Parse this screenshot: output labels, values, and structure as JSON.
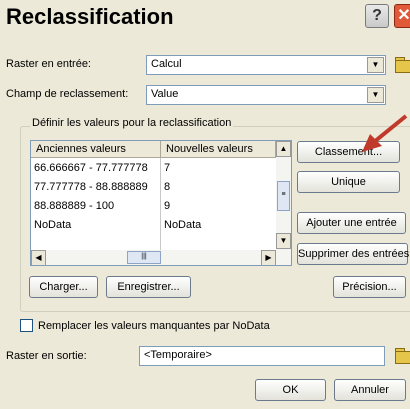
{
  "window": {
    "title": "Reclassification"
  },
  "input_raster": {
    "label": "Raster en entrée:",
    "value": "Calcul"
  },
  "reclass_field": {
    "label": "Champ de reclassement:",
    "value": "Value"
  },
  "group": {
    "title": "Définir les valeurs pour la reclassification"
  },
  "table": {
    "headers": [
      "Anciennes valeurs",
      "Nouvelles valeurs"
    ],
    "rows": [
      {
        "old": "66.666667 - 77.777778",
        "new": "7"
      },
      {
        "old": "77.777778 - 88.888889",
        "new": "8"
      },
      {
        "old": "88.888889 - 100",
        "new": "9"
      },
      {
        "old": "NoData",
        "new": "NoData"
      }
    ]
  },
  "buttons": {
    "classement": "Classement...",
    "unique": "Unique",
    "ajouter": "Ajouter une entrée",
    "supprimer": "Supprimer des entrées",
    "charger": "Charger...",
    "enregistrer": "Enregistrer...",
    "precision": "Précision...",
    "ok": "OK",
    "annuler": "Annuler"
  },
  "checkbox": {
    "label": "Remplacer les valeurs manquantes par NoData",
    "checked": false
  },
  "output_raster": {
    "label": "Raster en sortie:",
    "value": "<Temporaire>"
  },
  "colors": {
    "annotation_arrow": "#c0392b",
    "field_border": "#7f9db9"
  }
}
